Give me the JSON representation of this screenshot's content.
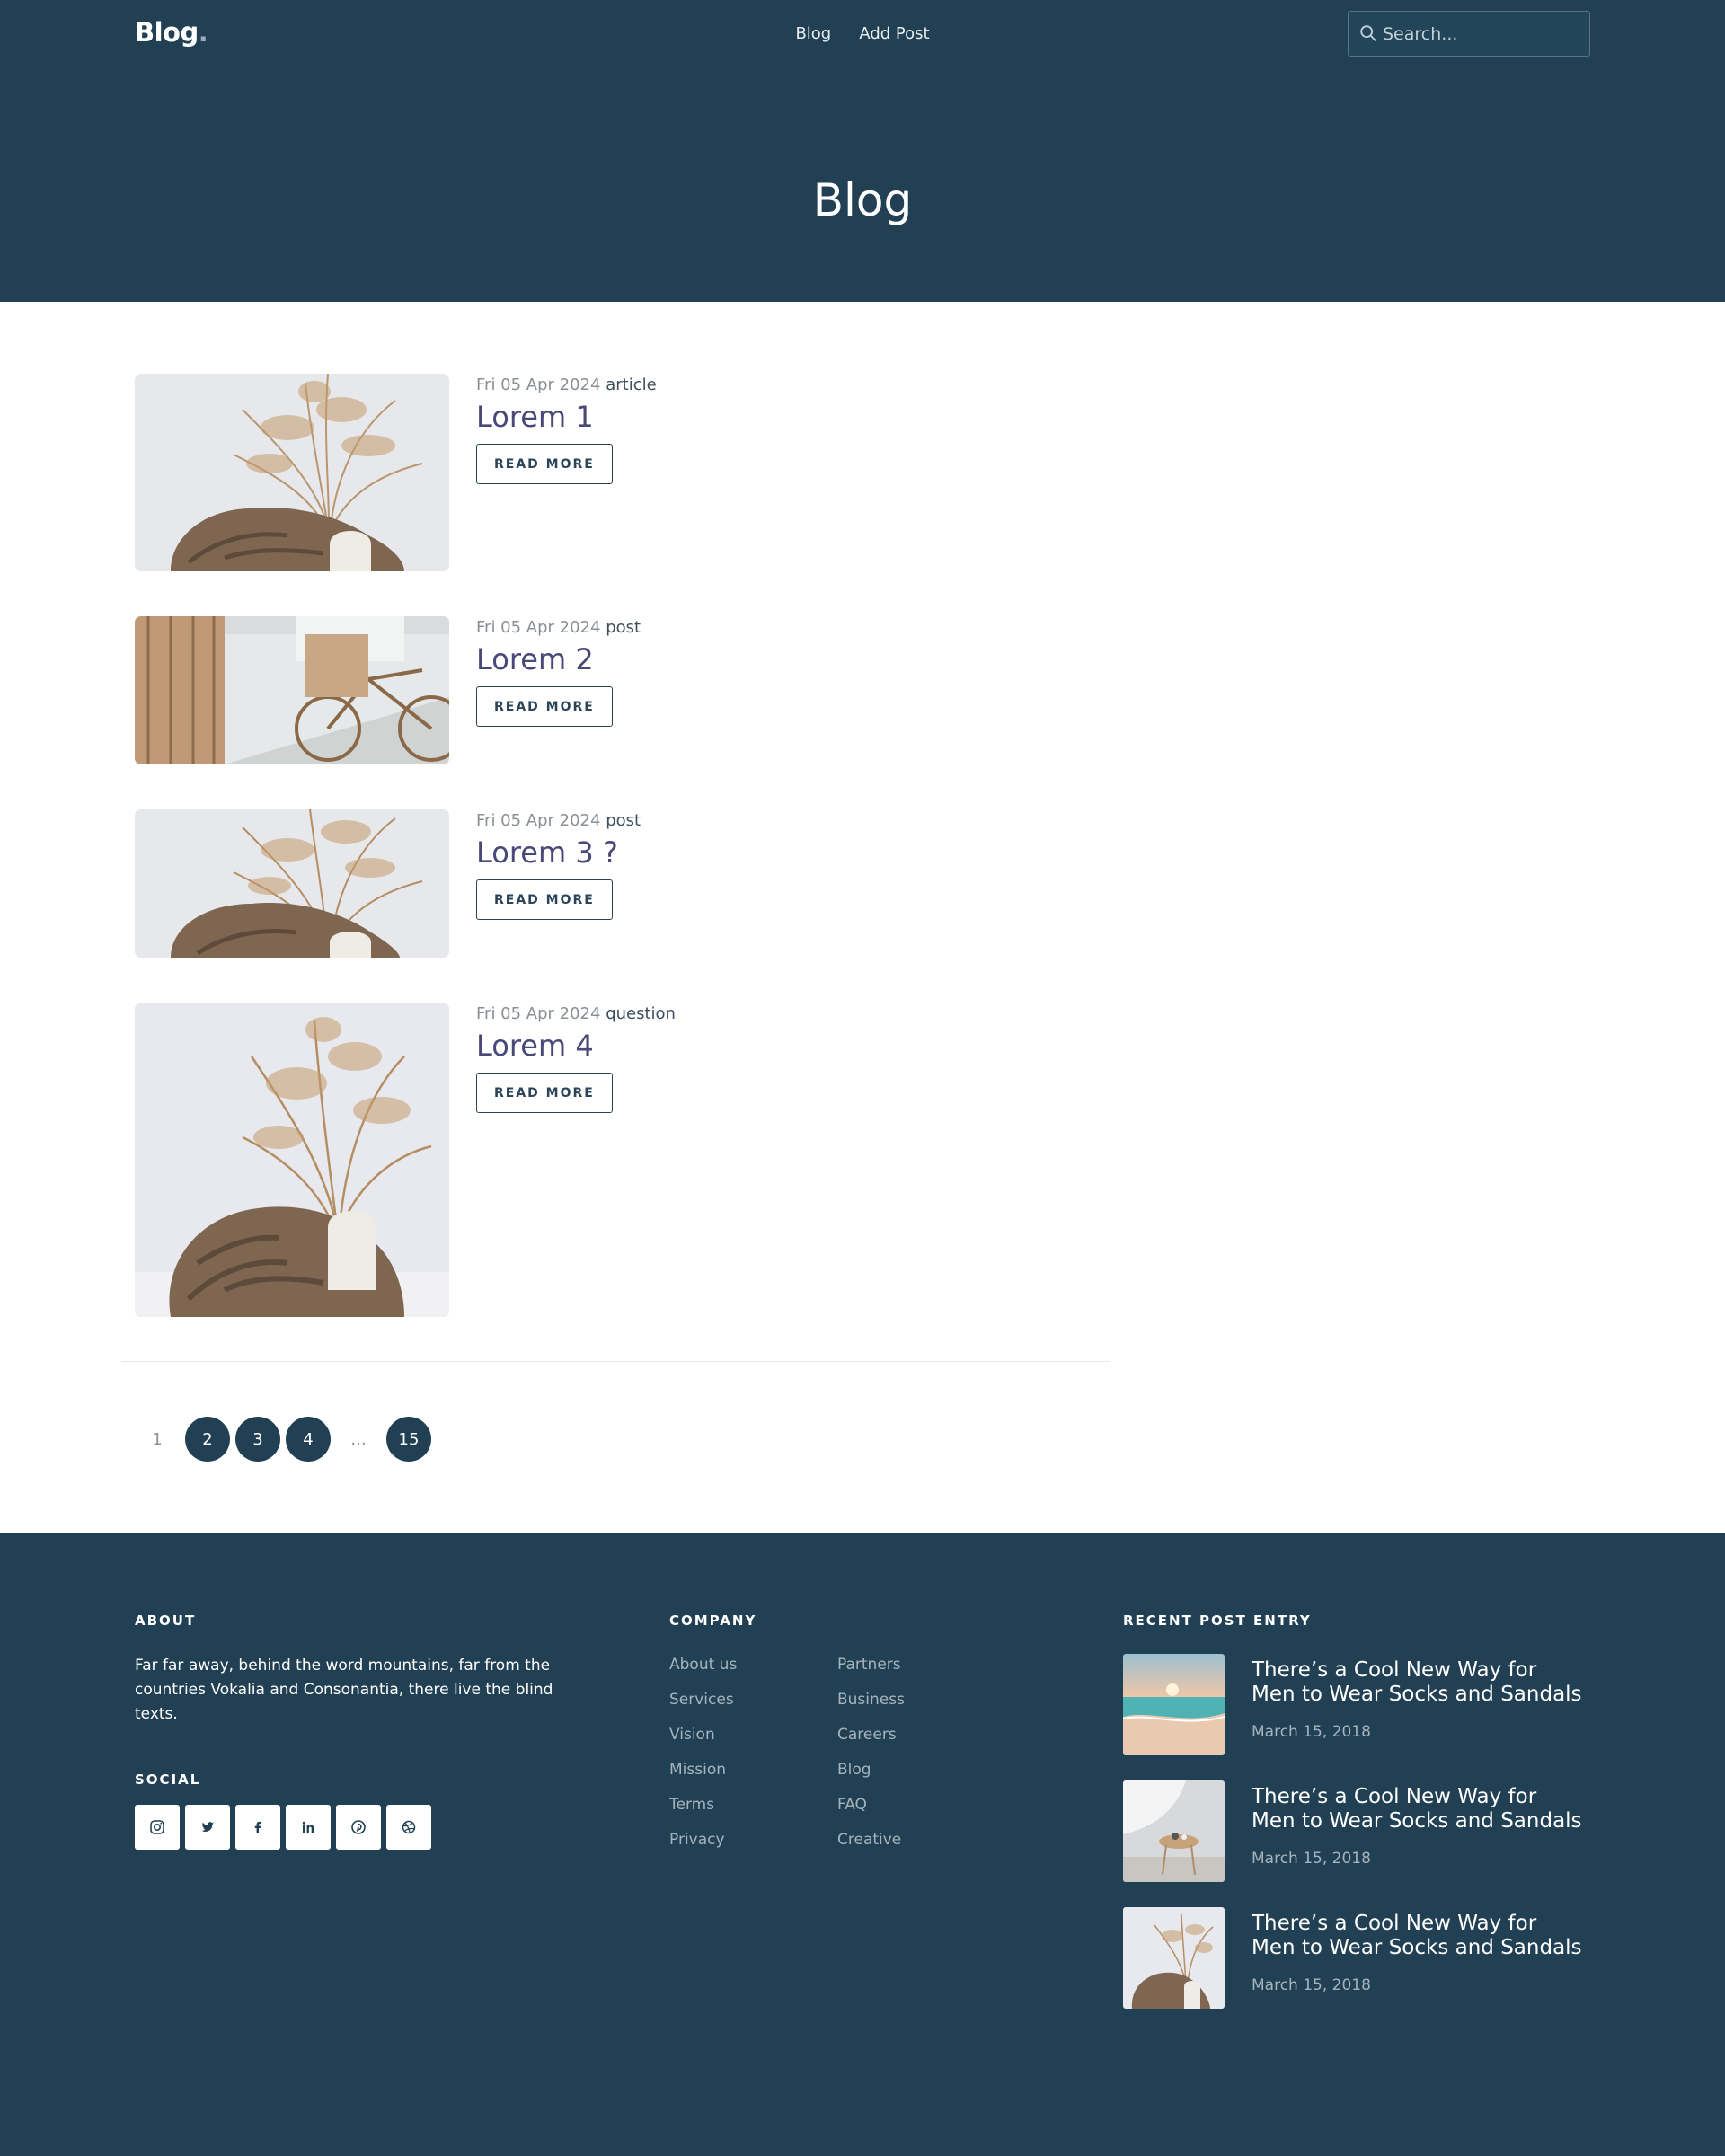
{
  "header": {
    "logo": "Blog",
    "logo_dot": ".",
    "nav": [
      "Blog",
      "Add Post"
    ],
    "search_placeholder": "Search...",
    "hero_title": "Blog"
  },
  "posts": [
    {
      "date": "Fri 05 Apr 2024",
      "category": "article",
      "title": "Lorem 1",
      "button": "READ MORE"
    },
    {
      "date": "Fri 05 Apr 2024",
      "category": "post",
      "title": "Lorem 2",
      "button": "READ MORE"
    },
    {
      "date": "Fri 05 Apr 2024",
      "category": "post",
      "title": "Lorem 3 ?",
      "button": "READ MORE"
    },
    {
      "date": "Fri 05 Apr 2024",
      "category": "question",
      "title": "Lorem 4",
      "button": "READ MORE"
    }
  ],
  "pagination": [
    "1",
    "2",
    "3",
    "4",
    "...",
    "15"
  ],
  "footer": {
    "about_heading": "ABOUT",
    "about_text": "Far far away, behind the word mountains, far from the countries Vokalia and Consonantia, there live the blind texts.",
    "social_heading": "SOCIAL",
    "social_icons": [
      "instagram-icon",
      "twitter-icon",
      "facebook-icon",
      "linkedin-icon",
      "pinterest-icon",
      "dribbble-icon"
    ],
    "company_heading": "COMPANY",
    "company_col1": [
      "About us",
      "Services",
      "Vision",
      "Mission",
      "Terms",
      "Privacy"
    ],
    "company_col2": [
      "Partners",
      "Business",
      "Careers",
      "Blog",
      "FAQ",
      "Creative"
    ],
    "recent_heading": "RECENT POST ENTRY",
    "recent": [
      {
        "title": "There’s a Cool New Way for Men to Wear Socks and Sandals",
        "date": "March 15, 2018"
      },
      {
        "title": "There’s a Cool New Way for Men to Wear Socks and Sandals",
        "date": "March 15, 2018"
      },
      {
        "title": "There’s a Cool New Way for Men to Wear Socks and Sandals",
        "date": "March 15, 2018"
      }
    ]
  },
  "colors": {
    "primary": "#224054",
    "title_purple": "#4a4878",
    "muted": "#8a8f94"
  }
}
